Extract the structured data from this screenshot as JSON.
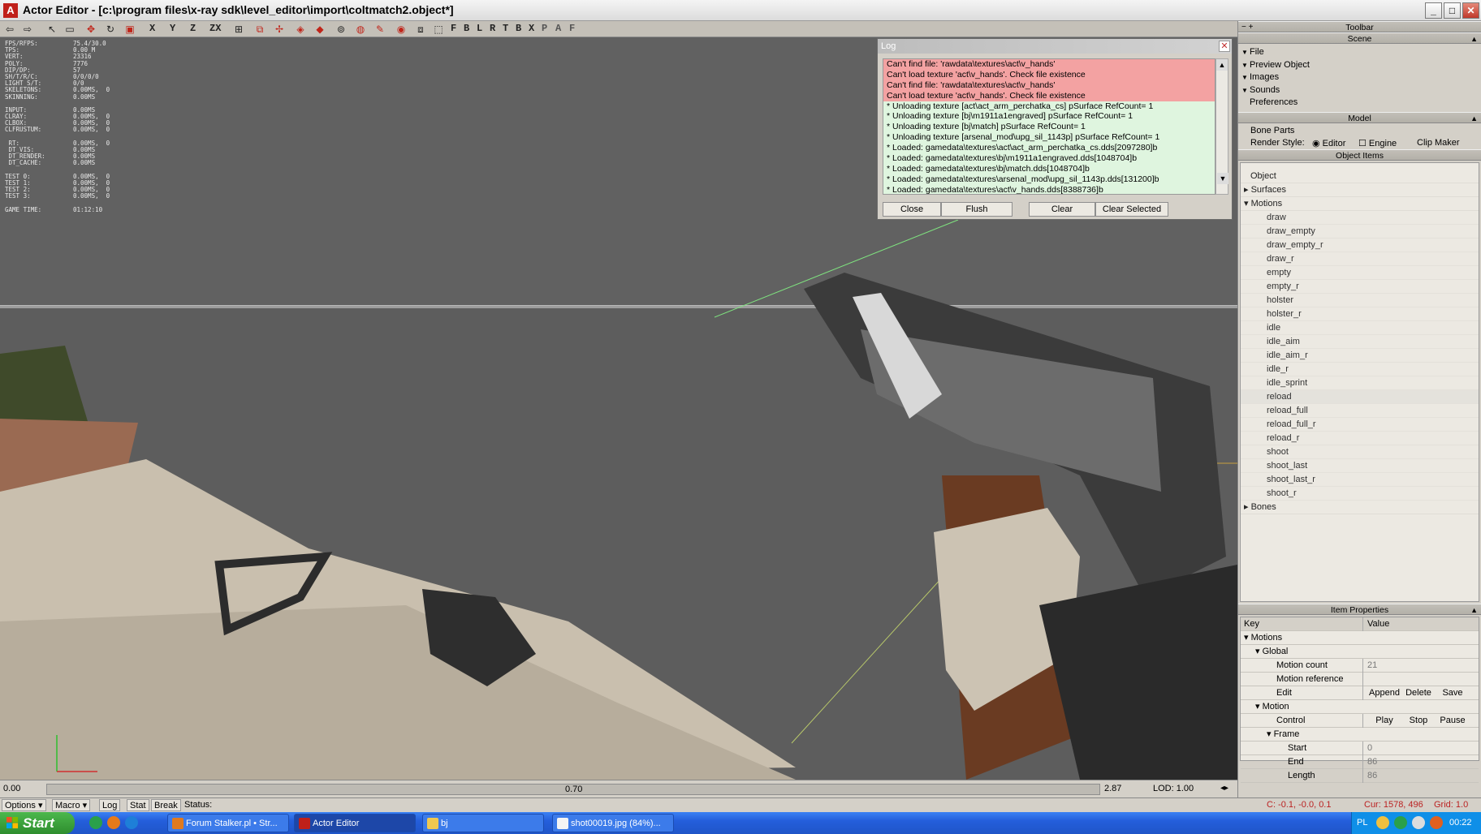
{
  "window": {
    "app_icon": "A",
    "title": "Actor Editor - [c:\\program files\\x-ray sdk\\level_editor\\import\\coltmatch2.object*]",
    "controls": {
      "minimize": "_",
      "maximize": "□",
      "close": "✕"
    }
  },
  "toolbar": {
    "axis_letters": [
      "X",
      "Y",
      "Z",
      "ZX"
    ],
    "view_letters": [
      "F",
      "B",
      "L",
      "R",
      "T",
      "B",
      "X",
      "P",
      "A",
      "F"
    ]
  },
  "stats": [
    {
      "k": "FPS/RFPS:",
      "v": "75.4/30.0"
    },
    {
      "k": "TPS:",
      "v": "0.00 M"
    },
    {
      "k": "VERT:",
      "v": "23316"
    },
    {
      "k": "POLY:",
      "v": "7776"
    },
    {
      "k": "DIP/DP:",
      "v": "57"
    },
    {
      "k": "SH/T/R/C:",
      "v": "0/0/0/0"
    },
    {
      "k": "LIGHT S/T:",
      "v": "0/0"
    },
    {
      "k": "SKELETONS:",
      "v": "0.00MS,  0"
    },
    {
      "k": "SKINNING:",
      "v": "0.00MS"
    },
    {
      "gap": true
    },
    {
      "k": "INPUT:",
      "v": "0.00MS"
    },
    {
      "k": "CLRAY:",
      "v": "0.00MS,  0"
    },
    {
      "k": "CLBOX:",
      "v": "0.00MS,  0"
    },
    {
      "k": "CLFRUSTUM:",
      "v": "0.00MS,  0"
    },
    {
      "gap": true
    },
    {
      "k": " RT:",
      "v": "0.00MS,  0"
    },
    {
      "k": " DT_VIS:",
      "v": "0.00MS"
    },
    {
      "k": " DT_RENDER:",
      "v": "0.00MS"
    },
    {
      "k": " DT_CACHE:",
      "v": "0.00MS"
    },
    {
      "gap": true
    },
    {
      "k": "TEST 0:",
      "v": "0.00MS,  0"
    },
    {
      "k": "TEST 1:",
      "v": "0.00MS,  0"
    },
    {
      "k": "TEST 2:",
      "v": "0.00MS,  0"
    },
    {
      "k": "TEST 3:",
      "v": "0.00MS,  0"
    },
    {
      "gap": true
    },
    {
      "k": "GAME TIME:",
      "v": "01:12:10"
    }
  ],
  "log": {
    "title": "Log",
    "close_glyph": "✕",
    "lines": [
      {
        "text": "Can't find file: 'rawdata\\textures\\act\\v_hands'",
        "type": "err"
      },
      {
        "text": "Can't load texture 'act\\v_hands'. Check file existence",
        "type": "err"
      },
      {
        "text": "Can't find file: 'rawdata\\textures\\act\\v_hands'",
        "type": "err"
      },
      {
        "text": "Can't load texture 'act\\v_hands'. Check file existence",
        "type": "err"
      },
      {
        "text": "* Unloading texture [act\\act_arm_perchatka_cs] pSurface RefCount= 1",
        "type": "ok"
      },
      {
        "text": "* Unloading texture [bj\\m1911a1engraved] pSurface RefCount= 1",
        "type": "ok"
      },
      {
        "text": "* Unloading texture [bj\\match] pSurface RefCount= 1",
        "type": "ok"
      },
      {
        "text": "* Unloading texture [arsenal_mod\\upg_sil_1143p] pSurface RefCount= 1",
        "type": "ok"
      },
      {
        "text": "* Loaded: gamedata\\textures\\act\\act_arm_perchatka_cs.dds[2097280]b",
        "type": "ok"
      },
      {
        "text": "* Loaded: gamedata\\textures\\bj\\m1911a1engraved.dds[1048704]b",
        "type": "ok"
      },
      {
        "text": "* Loaded: gamedata\\textures\\bj\\match.dds[1048704]b",
        "type": "ok"
      },
      {
        "text": "* Loaded: gamedata\\textures\\arsenal_mod\\upg_sil_1143p.dds[131200]b",
        "type": "ok"
      },
      {
        "text": "* Loaded: gamedata\\textures\\act\\v_hands.dds[8388736]b",
        "type": "ok"
      }
    ],
    "buttons": {
      "close": "Close",
      "flush": "Flush",
      "clear": "Clear",
      "clear_selected": "Clear Selected"
    }
  },
  "panel": {
    "toolbar_header": "Toolbar",
    "scene_header": "Scene",
    "scene_items": [
      {
        "label": "File",
        "arrow": true
      },
      {
        "label": "Preview Object",
        "arrow": true
      },
      {
        "label": "Images",
        "arrow": true
      },
      {
        "label": "Sounds",
        "arrow": true
      },
      {
        "label": "Preferences",
        "arrow": false
      }
    ],
    "model_header": "Model",
    "bone_parts": "Bone Parts",
    "render_style_label": "Render Style:",
    "render_editor": "Editor",
    "render_engine": "Engine",
    "clip_maker": "Clip Maker",
    "object_items_header": "Object Items",
    "tree": {
      "object": "Object",
      "surfaces": "Surfaces",
      "motions": "Motions",
      "bones": "Bones"
    },
    "motions": [
      "draw",
      "draw_empty",
      "draw_empty_r",
      "draw_r",
      "empty",
      "empty_r",
      "holster",
      "holster_r",
      "idle",
      "idle_aim",
      "idle_aim_r",
      "idle_r",
      "idle_sprint",
      "reload",
      "reload_full",
      "reload_full_r",
      "reload_r",
      "shoot",
      "shoot_last",
      "shoot_last_r",
      "shoot_r"
    ],
    "selected_motion": "reload",
    "item_props_header": "Item Properties",
    "props": {
      "key_col": "Key",
      "value_col": "Value",
      "motions": "Motions",
      "global": "Global",
      "motion_count": "Motion count",
      "motion_count_val": "21",
      "motion_reference": "Motion reference",
      "edit": "Edit",
      "append": "Append",
      "delete": "Delete",
      "save": "Save",
      "motion": "Motion",
      "control": "Control",
      "play": "Play",
      "stop": "Stop",
      "pause": "Pause",
      "frame": "Frame",
      "start": "Start",
      "start_val": "0",
      "end": "End",
      "end_val": "86",
      "length": "Length",
      "length_val": "86"
    }
  },
  "timeline": {
    "start": "0.00",
    "middle": "0.70",
    "end": "2.87",
    "lod": "LOD: 1.00"
  },
  "statusbar": {
    "options": "Options",
    "macro": "Macro",
    "log": "Log",
    "stat": "Stat",
    "break": "Break",
    "status": "Status:",
    "coords": "C: -0.1, -0.0, 0.1",
    "cursor": "Cur: 1578, 496",
    "grid": "Grid: 1.0"
  },
  "taskbar": {
    "start": "Start",
    "tasks": [
      {
        "label": "Forum Stalker.pl • Str...",
        "color": "#e07a1f",
        "active": false
      },
      {
        "label": "Actor Editor",
        "color": "#c0201a",
        "active": true
      },
      {
        "label": "bj",
        "color": "#f0c850",
        "active": false
      },
      {
        "label": "shot00019.jpg (84%)...",
        "color": "#f4f4f4",
        "active": false
      }
    ],
    "lang": "PL",
    "clock": "00:22"
  },
  "colors": {
    "viewport": "#5d5d5d",
    "log_error": "#f3a2a2",
    "log_ok": "#dff5df",
    "taskbar": "#245edb"
  }
}
